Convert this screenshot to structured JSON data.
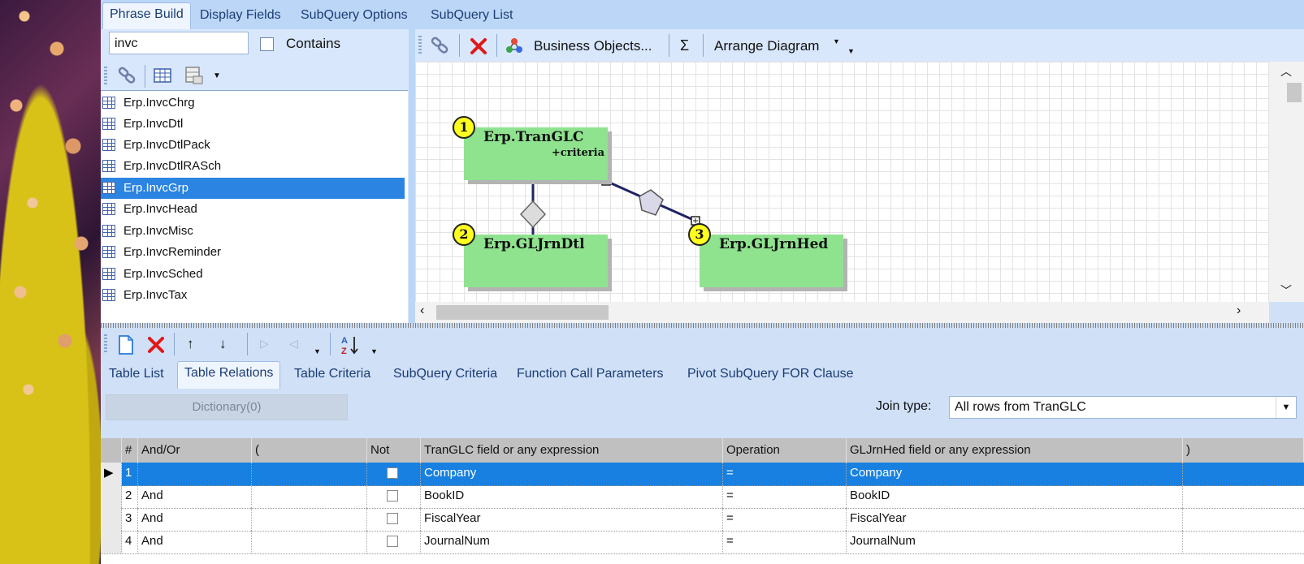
{
  "top_tabs": [
    "Phrase Build",
    "Display Fields",
    "SubQuery Options",
    "SubQuery List"
  ],
  "search": {
    "value": "invc",
    "contains_label": "Contains"
  },
  "table_list": [
    "Erp.InvcChrg",
    "Erp.InvcDtl",
    "Erp.InvcDtlPack",
    "Erp.InvcDtlRASch",
    "Erp.InvcGrp",
    "Erp.InvcHead",
    "Erp.InvcMisc",
    "Erp.InvcReminder",
    "Erp.InvcSched",
    "Erp.InvcTax"
  ],
  "table_list_selected": "Erp.InvcGrp",
  "diagram_toolbar": {
    "business_objects": "Business Objects...",
    "sigma": "Σ",
    "arrange": "Arrange Diagram"
  },
  "diagram": {
    "nodes": [
      {
        "num": "1",
        "name": "Erp.TranGLC",
        "sub": "+criteria"
      },
      {
        "num": "2",
        "name": "Erp.GLJrnDtl",
        "sub": ""
      },
      {
        "num": "3",
        "name": "Erp.GLJrnHed",
        "sub": ""
      }
    ]
  },
  "bottom_tabs": [
    "Table List",
    "Table Relations",
    "Table Criteria",
    "SubQuery Criteria",
    "Function Call Parameters",
    "Pivot SubQuery FOR Clause"
  ],
  "active_bottom_tab": "Table Relations",
  "dictionary_button": "Dictionary(0)",
  "join": {
    "label": "Join type:",
    "value": "All rows from TranGLC"
  },
  "grid": {
    "headers": [
      "#",
      "And/Or",
      "(",
      "Not",
      "TranGLC field or any expression",
      "Operation",
      "GLJrnHed field or any expression",
      ")"
    ],
    "rows": [
      {
        "num": "1",
        "andor": "",
        "open": "",
        "left": "Company",
        "op": "=",
        "right": "Company",
        "close": ""
      },
      {
        "num": "2",
        "andor": "And",
        "open": "",
        "left": "BookID",
        "op": "=",
        "right": "BookID",
        "close": ""
      },
      {
        "num": "3",
        "andor": "And",
        "open": "",
        "left": "FiscalYear",
        "op": "=",
        "right": "FiscalYear",
        "close": ""
      },
      {
        "num": "4",
        "andor": "And",
        "open": "",
        "left": "JournalNum",
        "op": "=",
        "right": "JournalNum",
        "close": ""
      }
    ]
  }
}
